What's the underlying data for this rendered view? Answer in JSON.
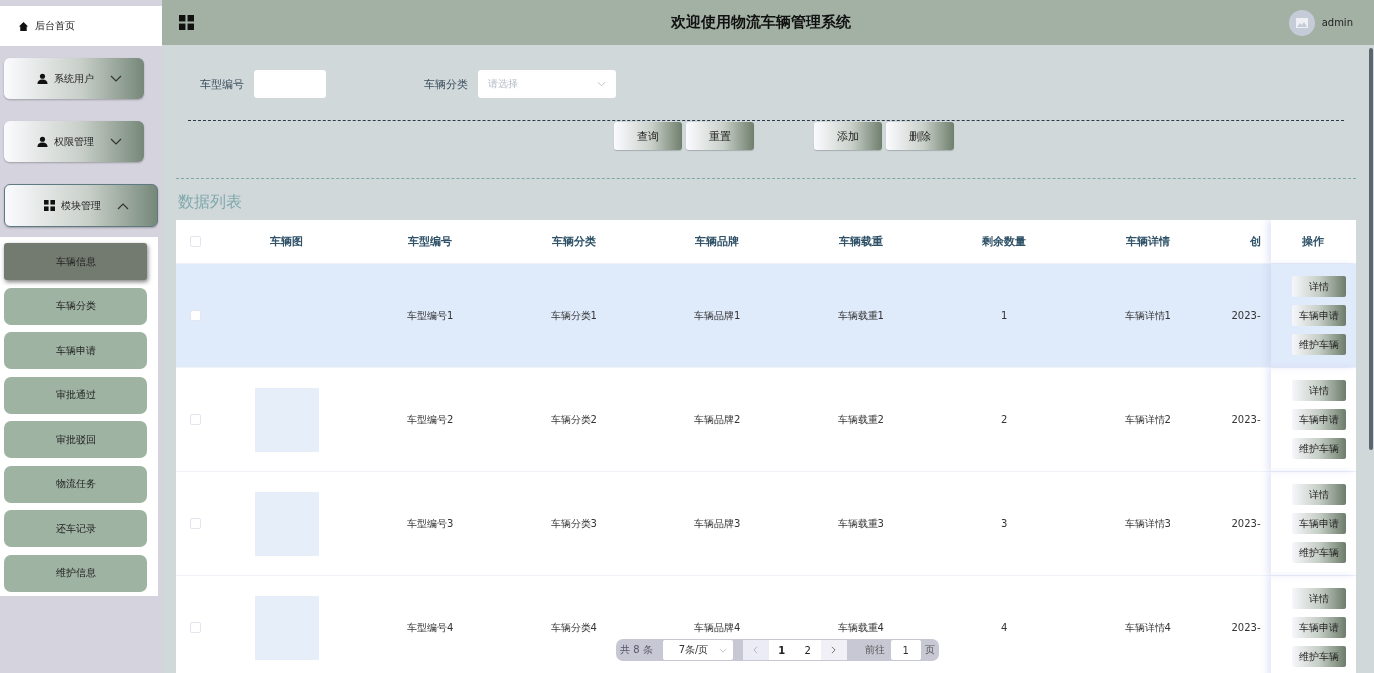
{
  "sidebar": {
    "home": {
      "label": "后台首页"
    },
    "groups": [
      {
        "label": "系统用户",
        "expanded": false
      },
      {
        "label": "权限管理",
        "expanded": false
      },
      {
        "label": "模块管理",
        "expanded": true,
        "children": [
          {
            "label": "车辆信息",
            "selected": true
          },
          {
            "label": "车辆分类",
            "selected": false
          },
          {
            "label": "车辆申请",
            "selected": false
          },
          {
            "label": "审批通过",
            "selected": false
          },
          {
            "label": "审批驳回",
            "selected": false
          },
          {
            "label": "物流任务",
            "selected": false
          },
          {
            "label": "还车记录",
            "selected": false
          },
          {
            "label": "维护信息",
            "selected": false
          }
        ]
      }
    ]
  },
  "header": {
    "title": "欢迎使用物流车辆管理系统",
    "user": "admin"
  },
  "search": {
    "fields": [
      {
        "label": "车型编号",
        "kind": "text"
      },
      {
        "label": "车辆分类",
        "kind": "select",
        "placeholder": "请选择"
      }
    ],
    "buttons": [
      {
        "label": "查询"
      },
      {
        "label": "重置"
      },
      {
        "label": "添加"
      },
      {
        "label": "删除"
      }
    ]
  },
  "list_title": "数据列表",
  "table": {
    "all_checked": false,
    "columns": [
      "车辆图",
      "车型编号",
      "车辆分类",
      "车辆品牌",
      "车辆载重",
      "剩余数量",
      "车辆详情",
      "创",
      "操作"
    ],
    "rows": [
      {
        "checked": false,
        "highlighted": true,
        "image": false,
        "cells": [
          "",
          "车型编号1",
          "车辆分类1",
          "车辆品牌1",
          "车辆载重1",
          "1",
          "车辆详情1",
          "2023-"
        ],
        "actions": [
          "详情",
          "车辆申请",
          "维护车辆"
        ]
      },
      {
        "checked": false,
        "highlighted": false,
        "image": true,
        "cells": [
          "",
          "车型编号2",
          "车辆分类2",
          "车辆品牌2",
          "车辆载重2",
          "2",
          "车辆详情2",
          "2023-"
        ],
        "actions": [
          "详情",
          "车辆申请",
          "维护车辆"
        ]
      },
      {
        "checked": false,
        "highlighted": false,
        "image": true,
        "cells": [
          "",
          "车型编号3",
          "车辆分类3",
          "车辆品牌3",
          "车辆载重3",
          "3",
          "车辆详情3",
          "2023-"
        ],
        "actions": [
          "详情",
          "车辆申请",
          "维护车辆"
        ]
      },
      {
        "checked": false,
        "highlighted": false,
        "image": true,
        "cells": [
          "",
          "车型编号4",
          "车辆分类4",
          "车辆品牌4",
          "车辆载重4",
          "4",
          "车辆详情4",
          "2023-"
        ],
        "actions": [
          "详情",
          "车辆申请",
          "维护车辆"
        ]
      }
    ]
  },
  "pagination": {
    "total": "共 8 条",
    "page_size": "7条/页",
    "pages": [
      {
        "label": "1",
        "selected": true
      },
      {
        "label": "2",
        "selected": false
      }
    ],
    "goto_label": "前往",
    "goto_value": "1",
    "goto_suffix": "页"
  }
}
